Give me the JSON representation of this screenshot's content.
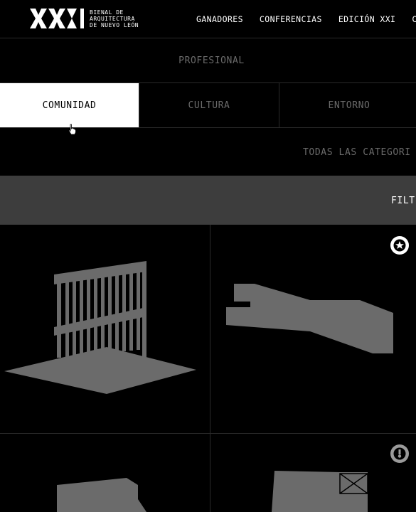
{
  "header": {
    "logo_line1": "BIENAL DE",
    "logo_line2": "ARQUITECTURA",
    "logo_line3": "DE NUEVO LEÓN",
    "nav": [
      "GANADORES",
      "CONFERENCIAS",
      "EDICIÓN XXI",
      "CA"
    ]
  },
  "filters": {
    "professional": "PROFESIONAL",
    "tabs": [
      "COMUNIDAD",
      "CULTURA",
      "ENTORNO"
    ],
    "active_tab": "COMUNIDAD",
    "all_categories": "TODAS LAS CATEGORI",
    "filter_label": "FILT"
  },
  "colors": {
    "background": "#000000",
    "filter_bar": "#3d3d3d",
    "model_gray": "#6b6b6b",
    "muted_text": "#6a6a6a"
  },
  "cards": [
    {
      "icon": "comunidad-model",
      "badge": null
    },
    {
      "icon": "cultura-model",
      "badge": "star-icon"
    },
    {
      "icon": "model-3",
      "badge": null
    },
    {
      "icon": "model-4",
      "badge": "medal-icon"
    }
  ]
}
